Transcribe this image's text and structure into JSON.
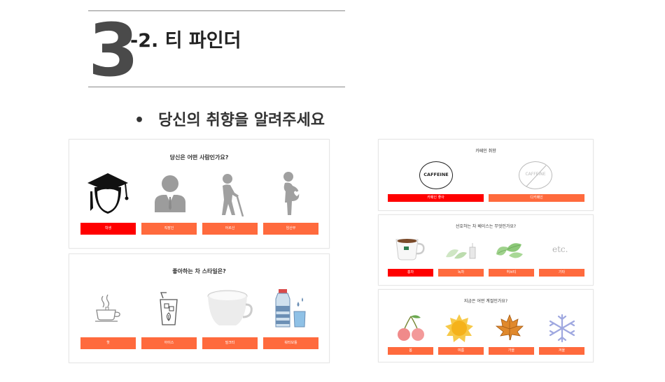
{
  "header": {
    "section_number": "3",
    "title": "-2. 티 파인더",
    "bullet": "•",
    "subtitle": "당신의 취향을 알려주세요"
  },
  "colors": {
    "selected": "#ff0000",
    "option": "#ff6a3d"
  },
  "cards": {
    "who": {
      "title": "당신은 어떤 사람인가요?",
      "options": [
        {
          "label": "학생",
          "icon": "graduate-icon",
          "selected": true
        },
        {
          "label": "직장인",
          "icon": "office-worker-icon",
          "selected": false
        },
        {
          "label": "어르신",
          "icon": "elderly-icon",
          "selected": false
        },
        {
          "label": "임산부",
          "icon": "pregnant-icon",
          "selected": false
        }
      ]
    },
    "style": {
      "title": "좋아하는 차 스타일은?",
      "options": [
        {
          "label": "핫",
          "icon": "hot-tea-icon",
          "selected": false
        },
        {
          "label": "아이스",
          "icon": "iced-tea-icon",
          "selected": false
        },
        {
          "label": "밀크티",
          "icon": "milk-tea-icon",
          "selected": false
        },
        {
          "label": "워터보틀",
          "icon": "water-bottle-icon",
          "selected": false
        }
      ]
    },
    "caffeine": {
      "title": "카페인 취향",
      "badge_text": "CAFFEINE",
      "options": [
        {
          "label": "카페인 좋아",
          "icon": "caffeine-icon",
          "selected": true
        },
        {
          "label": "디카페인",
          "icon": "no-caffeine-icon",
          "selected": false
        }
      ]
    },
    "base": {
      "title": "선호하는 차 베이스는 무엇인가요?",
      "etc_text": "etc.",
      "options": [
        {
          "label": "홍차",
          "icon": "black-tea-icon",
          "selected": true
        },
        {
          "label": "녹차",
          "icon": "green-tea-icon",
          "selected": false
        },
        {
          "label": "허브티",
          "icon": "herb-tea-icon",
          "selected": false
        },
        {
          "label": "기타",
          "icon": "etc-icon",
          "selected": false
        }
      ]
    },
    "season": {
      "title": "지금은 어떤 계절인가요?",
      "options": [
        {
          "label": "봄",
          "icon": "cherry-icon",
          "selected": false
        },
        {
          "label": "여름",
          "icon": "sun-icon",
          "selected": false
        },
        {
          "label": "가을",
          "icon": "maple-leaf-icon",
          "selected": false
        },
        {
          "label": "겨울",
          "icon": "snowflake-icon",
          "selected": false
        }
      ]
    }
  }
}
